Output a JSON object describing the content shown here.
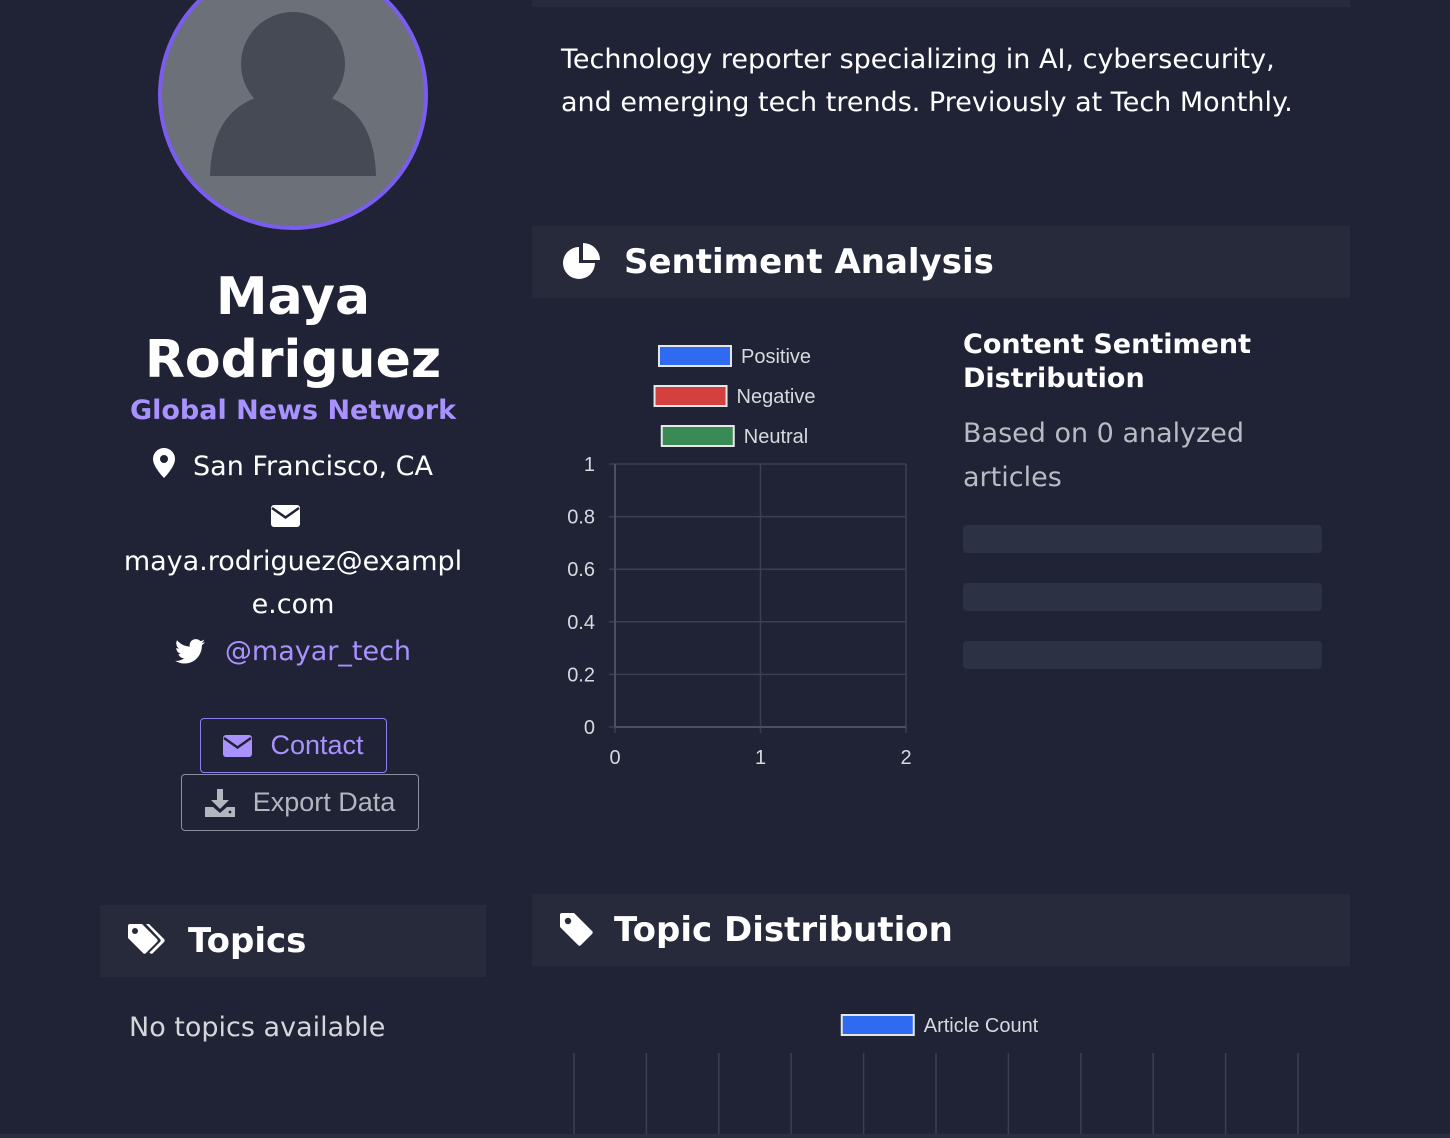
{
  "profile": {
    "name": "Maya Rodriguez",
    "outlet": "Global News Network",
    "location": "San Francisco, CA",
    "email": "maya.rodriguez@example.com",
    "twitter": "@mayar_tech",
    "contact_label": "Contact",
    "export_label": "Export Data"
  },
  "topics_card": {
    "title": "Topics",
    "empty_text": "No topics available"
  },
  "bio": "Technology reporter specializing in AI, cybersecurity, and emerging tech trends. Previously at Tech Monthly.",
  "sentiment": {
    "title": "Sentiment Analysis",
    "side_title": "Content Sentiment Distribution",
    "side_subtitle": "Based on 0 analyzed articles",
    "skeleton_bars": 3
  },
  "topic_distribution": {
    "title": "Topic Distribution"
  },
  "colors": {
    "accent": "#7b5cf0",
    "link": "#a992ff",
    "positive": "#2f6bf0",
    "negative": "#d43f3f",
    "neutral": "#3a8a55"
  },
  "chart_data": [
    {
      "type": "bar",
      "series": [
        {
          "name": "Positive",
          "color": "#2f6bf0",
          "values": []
        },
        {
          "name": "Negative",
          "color": "#d43f3f",
          "values": []
        },
        {
          "name": "Neutral",
          "color": "#3a8a55",
          "values": []
        }
      ],
      "x_ticks": [
        "0",
        "1",
        "2"
      ],
      "y_ticks": [
        "0",
        "0.2",
        "0.4",
        "0.6",
        "0.8",
        "1"
      ],
      "xlim": [
        0,
        2
      ],
      "ylim": [
        0,
        1
      ],
      "legend": "top",
      "grid": true
    },
    {
      "type": "bar",
      "series": [
        {
          "name": "Article Count",
          "color": "#2f6bf0",
          "values": []
        }
      ],
      "legend": "top",
      "grid": true
    }
  ]
}
